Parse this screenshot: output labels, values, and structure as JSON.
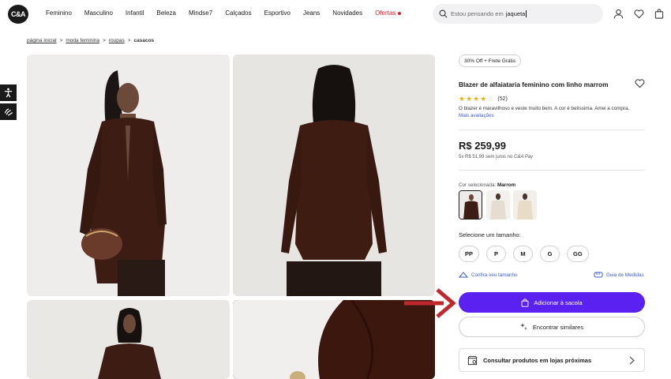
{
  "header": {
    "logo_text": "C&A",
    "nav": [
      "Feminino",
      "Masculino",
      "Infantil",
      "Beleza",
      "Mindse7",
      "Calçados",
      "Esportivo",
      "Jeans",
      "Novidades"
    ],
    "offers_label": "Ofertas",
    "search": {
      "placeholder": "Estou pensando em",
      "value": "jaqueta"
    }
  },
  "breadcrumb": [
    "página inicial",
    "moda feminina",
    "roupas",
    "casacos"
  ],
  "product": {
    "badge": "30% Off + Frete Grátis",
    "title": "Blazer de alfaiataria feminino com linho marrom",
    "rating": 4,
    "rating_max": 5,
    "review_count": "(52)",
    "review_excerpt": "O blazer é maravilhoso e veste muito bem. A cor é belíssima. Amei a compra.",
    "more_reviews": "Mais avaliações",
    "price": "R$ 259,99",
    "installments": "5x R$ 51,99 sem juros no",
    "pay_method": "C&A Pay",
    "color_label": "Cor selecionada:",
    "color_value": "Marrom",
    "size_label": "Selecione um tamanho:",
    "sizes": [
      "PP",
      "P",
      "M",
      "G",
      "GG"
    ],
    "fit_link": "Confira seu tamanho",
    "guide_link": "Guia de Medidas",
    "add_button": "Adicionar à sacola",
    "similar_button": "Encontrar similares",
    "stores_button": "Consultar produtos em lojas próximas"
  },
  "colors": {
    "accent": "#5b21f0",
    "offer": "#e11d2e",
    "star": "#e8b21a",
    "link": "#3b5bdb",
    "annotation_arrow": "#c0282d"
  }
}
